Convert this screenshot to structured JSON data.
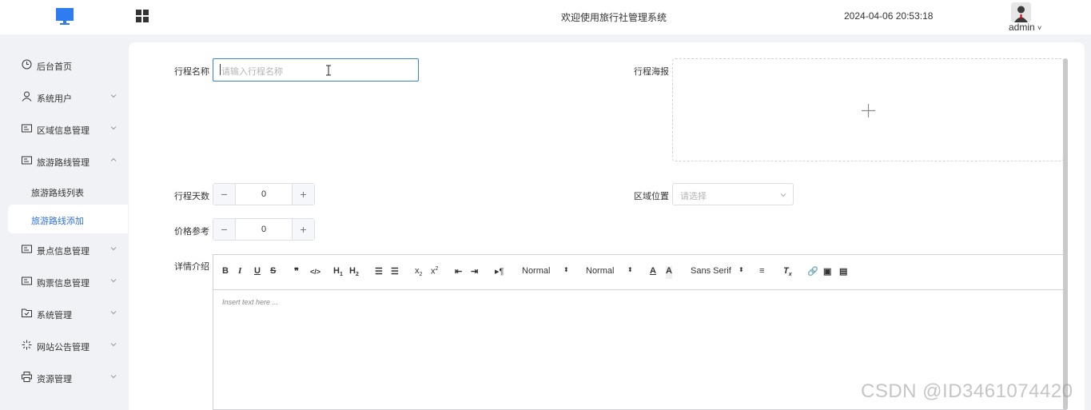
{
  "header": {
    "logo_icon": "monitor-icon",
    "menu_icon": "grid-icon",
    "welcome": "欢迎使用旅行社管理系统",
    "datetime": "2024-04-06 20:53:18",
    "user": "admin",
    "user_caret": "˅"
  },
  "sidebar": {
    "items": [
      {
        "label": "后台首页",
        "icon": "clock-icon"
      },
      {
        "label": "系统用户",
        "icon": "user-icon"
      },
      {
        "label": "区域信息管理",
        "icon": "card-icon"
      },
      {
        "label": "旅游路线管理",
        "icon": "card-icon"
      },
      {
        "label": "景点信息管理",
        "icon": "card-icon"
      },
      {
        "label": "购票信息管理",
        "icon": "card-icon"
      },
      {
        "label": "系统管理",
        "icon": "folder-icon"
      },
      {
        "label": "网站公告管理",
        "icon": "sparkle-icon"
      },
      {
        "label": "资源管理",
        "icon": "print-icon"
      }
    ],
    "sub_items": [
      {
        "label": "旅游路线列表"
      },
      {
        "label": "旅游路线添加"
      }
    ],
    "accent": "#2f6fdc"
  },
  "form": {
    "name_label": "行程名称",
    "name_placeholder": "请输入行程名称",
    "poster_label": "行程海报",
    "days_label": "行程天数",
    "days_value": "0",
    "price_label": "价格参考",
    "price_value": "0",
    "region_label": "区域位置",
    "region_placeholder": "请选择",
    "detail_label": "详情介绍"
  },
  "editor": {
    "header_select": "Normal",
    "size_select": "Normal",
    "font_select": "Sans Serif",
    "placeholder": "Insert text here ..."
  },
  "watermark": "CSDN @ID3461074420"
}
